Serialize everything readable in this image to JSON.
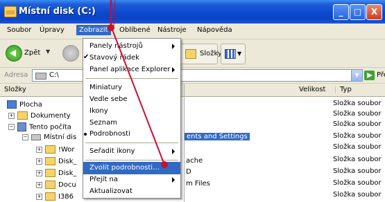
{
  "window": {
    "title": "Místní disk (C:)"
  },
  "title_buttons": {
    "minimize": "_",
    "maximize": "□",
    "close": "X"
  },
  "menubar": {
    "items": [
      "Soubor",
      "Úpravy",
      "Zobrazit",
      "Oblíbené",
      "Nástroje",
      "Nápověda"
    ],
    "active": "Zobrazit"
  },
  "toolbar": {
    "back_label": "Zpět",
    "folders_label": "Složky"
  },
  "address": {
    "label": "Adresa",
    "value": "C:\\",
    "go_label": "Přejít"
  },
  "folders_pane": {
    "header": "Složky",
    "tree": [
      "Plocha",
      "Dokumenty",
      "Tento počíta",
      "Místní dis",
      "!Wor",
      "Disk_",
      "Disk_",
      "Docu",
      "I386"
    ]
  },
  "content": {
    "columns": {
      "size": "Velikost",
      "type": "Typ"
    },
    "row_types": [
      "Složka soubor",
      "Složka soubor",
      "Složka soubor",
      "Složka soubor",
      "Složka soubor",
      "Složka soubor",
      "Složka soubor",
      "Složka soubor",
      "Složka soubor"
    ],
    "visible_names": [
      "ents and Settings",
      "ache",
      "D",
      "m Files"
    ]
  },
  "view_menu": {
    "items": [
      {
        "label": "Panely nástrojů",
        "submenu": true
      },
      {
        "label": "Stavový řádek",
        "checked": true
      },
      {
        "label": "Panel aplikace Explorer",
        "submenu": true
      },
      {
        "label": "Miniatury"
      },
      {
        "label": "Vedle sebe"
      },
      {
        "label": "Ikony"
      },
      {
        "label": "Seznam"
      },
      {
        "label": "Podrobnosti",
        "selected_radio": true
      },
      {
        "label": "Seřadit ikony",
        "submenu": true
      },
      {
        "label": "Zvolit podrobnosti…",
        "highlighted": true
      },
      {
        "label": "Přejít na",
        "submenu": true
      },
      {
        "label": "Aktualizovat"
      }
    ]
  },
  "colors": {
    "titlebar": "#0a48d0",
    "highlight": "#316ac5",
    "annotation": "#c8102e"
  }
}
